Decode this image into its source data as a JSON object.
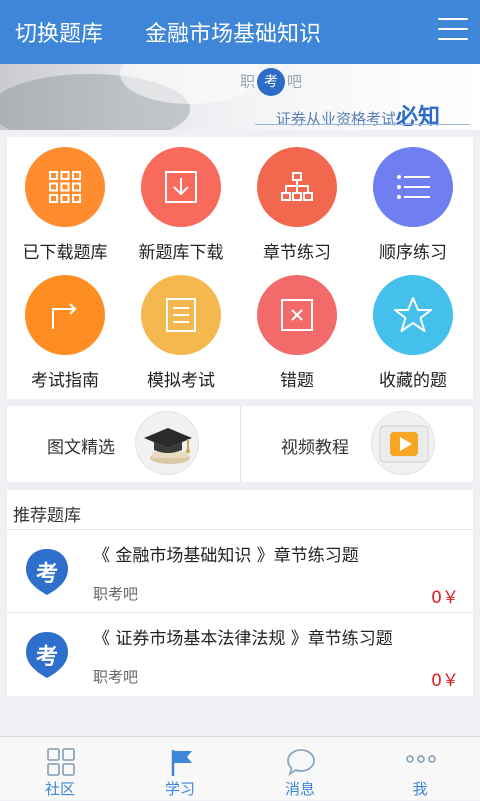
{
  "header": {
    "switch_label": "切换题库",
    "title": "金融市场基础知识"
  },
  "banner": {
    "brand_left": "职",
    "brand_circle": "考",
    "brand_right": "吧",
    "tagline": "证券从业资格考试",
    "tagline_bold": "必知"
  },
  "grid": {
    "items": [
      {
        "label": "已下载题库",
        "icon": "grid-icon",
        "color": "#ff8c2e"
      },
      {
        "label": "新题库下载",
        "icon": "download-icon",
        "color": "#f86b5c"
      },
      {
        "label": "章节练习",
        "icon": "tree-icon",
        "color": "#f2684e"
      },
      {
        "label": "顺序练习",
        "icon": "list-icon",
        "color": "#6f7ef0"
      },
      {
        "label": "考试指南",
        "icon": "arrow-turn-icon",
        "color": "#ff8e22"
      },
      {
        "label": "模拟考试",
        "icon": "document-icon",
        "color": "#f5b84f"
      },
      {
        "label": "错题",
        "icon": "x-box-icon",
        "color": "#f26a6a"
      },
      {
        "label": "收藏的题",
        "icon": "star-icon",
        "color": "#45c0ec"
      }
    ]
  },
  "media": {
    "left_label": "图文精选",
    "right_label": "视频教程"
  },
  "recommend": {
    "title": "推荐题库",
    "items": [
      {
        "name": "《 金融市场基础知识 》章节练习题",
        "source": "职考吧",
        "price": "0￥",
        "badge": "考"
      },
      {
        "name": "《 证券市场基本法律法规 》章节练习题",
        "source": "职考吧",
        "price": "0￥",
        "badge": "考"
      }
    ]
  },
  "tabbar": {
    "items": [
      {
        "label": "社区",
        "icon": "community-icon"
      },
      {
        "label": "学习",
        "icon": "flag-icon"
      },
      {
        "label": "消息",
        "icon": "chat-bubble-icon"
      },
      {
        "label": "我",
        "icon": "more-dots-icon"
      }
    ]
  },
  "colors": {
    "primary": "#3f86d8",
    "price": "#e02020"
  }
}
